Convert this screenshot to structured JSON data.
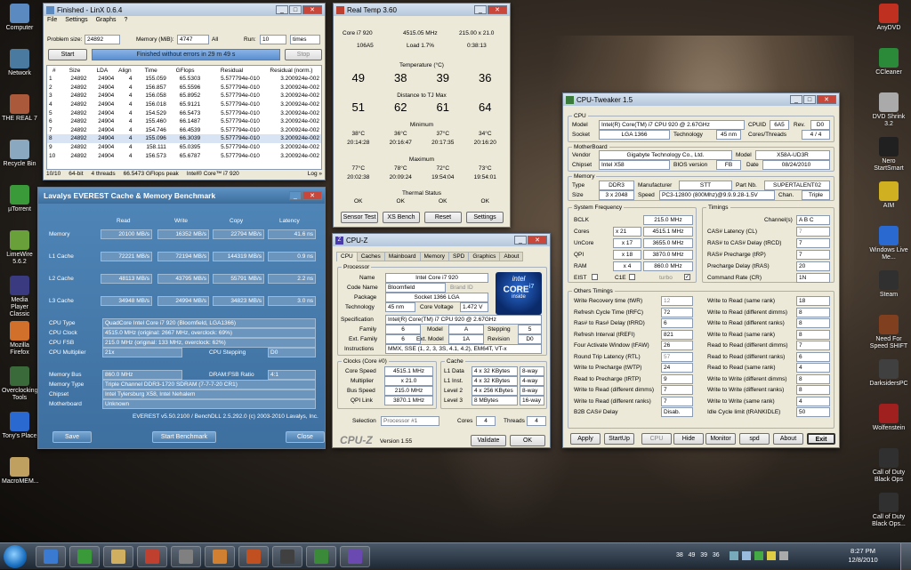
{
  "desktop": {
    "left_icons": [
      "Computer",
      "Network",
      "THE REAL 7",
      "Recycle Bin",
      "µTorrent",
      "LimeWire 5.6.2",
      "Media Player Classic",
      "Mozilla Firefox",
      "Overclocking Tools",
      "Tony's Place",
      "MacroMEM..."
    ],
    "right_icons": [
      "AnyDVD",
      "CCleaner",
      "DVD Shrink 3.2",
      "Nero StartSmart",
      "AIM",
      "Windows Live Me...",
      "Steam",
      "Need For Speed SHIFT",
      "DarksidersPC",
      "Wolfenstein",
      "Call of Duty Black Ops",
      "Call of Duty Black Ops..."
    ]
  },
  "linx": {
    "title": "Finished - LinX 0.6.4",
    "menu": [
      "File",
      "Settings",
      "Graphs",
      "?"
    ],
    "problem_size_label": "Problem size:",
    "problem_size": "24892",
    "memory_label": "Memory (MiB):",
    "memory": "4747",
    "all": "All",
    "run_label": "Run:",
    "run": "10",
    "run_unit": "times",
    "start": "Start",
    "status": "Finished without errors in 29 m 49 s",
    "stop": "Stop",
    "headers": [
      "#",
      "Size",
      "LDA",
      "Align",
      "Time",
      "GFlops",
      "Residual",
      "Residual (norm.)"
    ],
    "rows": [
      [
        "1",
        "24892",
        "24904",
        "4",
        "155.059",
        "65.5303",
        "5.577794e-010",
        "3.200924e-002"
      ],
      [
        "2",
        "24892",
        "24904",
        "4",
        "156.857",
        "65.5596",
        "5.577794e-010",
        "3.200924e-002"
      ],
      [
        "3",
        "24892",
        "24904",
        "4",
        "156.058",
        "65.8952",
        "5.577794e-010",
        "3.200924e-002"
      ],
      [
        "4",
        "24892",
        "24904",
        "4",
        "156.018",
        "65.9121",
        "5.577794e-010",
        "3.200924e-002"
      ],
      [
        "5",
        "24892",
        "24904",
        "4",
        "154.529",
        "66.5473",
        "5.577794e-010",
        "3.200924e-002"
      ],
      [
        "6",
        "24892",
        "24904",
        "4",
        "155.460",
        "66.1487",
        "5.577794e-010",
        "3.200924e-002"
      ],
      [
        "7",
        "24892",
        "24904",
        "4",
        "154.746",
        "66.4539",
        "5.577794e-010",
        "3.200924e-002"
      ],
      [
        "8",
        "24892",
        "24904",
        "4",
        "155.096",
        "66.3039",
        "5.577794e-010",
        "3.200924e-002"
      ],
      [
        "9",
        "24892",
        "24904",
        "4",
        "158.111",
        "65.0395",
        "5.577794e-010",
        "3.200924e-002"
      ],
      [
        "10",
        "24892",
        "24904",
        "4",
        "156.573",
        "65.6787",
        "5.577794e-010",
        "3.200924e-002"
      ]
    ],
    "footer": [
      "10/10",
      "64-bit",
      "4 threads",
      "66.5473 GFlops peak",
      "Intel® Core™ i7 920",
      "Log »"
    ]
  },
  "realtemp": {
    "title": "Real Temp 3.60",
    "cpu": "Core i7 920",
    "freq": "4515.05 MHz",
    "mult": "215.00 x 21.0",
    "id": "106A5",
    "load": "Load  1.7%",
    "time": "0:38:13",
    "temp_label": "Temperature (°C)",
    "temps": [
      "49",
      "38",
      "39",
      "36"
    ],
    "dist_label": "Distance to TJ Max",
    "dists": [
      "51",
      "62",
      "61",
      "64"
    ],
    "min_label": "Minimum",
    "mins": [
      "38°C",
      "36°C",
      "37°C",
      "34°C"
    ],
    "min_times": [
      "20:14:28",
      "20:16:47",
      "20:17:35",
      "20:16:20"
    ],
    "max_label": "Maximum",
    "maxs": [
      "77°C",
      "78°C",
      "72°C",
      "73°C"
    ],
    "max_times": [
      "20:02:38",
      "20:09:24",
      "19:54:04",
      "19:54:01"
    ],
    "thermal_label": "Thermal Status",
    "thermal": [
      "OK",
      "OK",
      "OK",
      "OK"
    ],
    "buttons": [
      "Sensor Test",
      "XS Bench",
      "Reset",
      "Settings"
    ]
  },
  "everest": {
    "title": "Lavalys EVEREST Cache & Memory Benchmark",
    "cols": [
      "Read",
      "Write",
      "Copy",
      "Latency"
    ],
    "rows": [
      {
        "label": "Memory",
        "v": [
          "20100 MB/s",
          "16352 MB/s",
          "22794 MB/s",
          "41.6 ns"
        ]
      },
      {
        "label": "L1 Cache",
        "v": [
          "72221 MB/s",
          "72194 MB/s",
          "144319 MB/s",
          "0.9 ns"
        ]
      },
      {
        "label": "L2 Cache",
        "v": [
          "48113 MB/s",
          "43795 MB/s",
          "55791 MB/s",
          "2.2 ns"
        ]
      },
      {
        "label": "L3 Cache",
        "v": [
          "34948 MB/s",
          "24994 MB/s",
          "34823 MB/s",
          "3.0 ns"
        ]
      }
    ],
    "cpu_type_label": "CPU Type",
    "cpu_type": "QuadCore Intel Core i7 920  (Bloomfield, LGA1366)",
    "cpu_clock_label": "CPU Clock",
    "cpu_clock": "4515.0 MHz  (original: 2667 MHz, overclock: 69%)",
    "cpu_fsb_label": "CPU FSB",
    "cpu_fsb": "215.0 MHz  (original: 133 MHz, overclock: 62%)",
    "cpu_mult_label": "CPU Multiplier",
    "cpu_mult": "21x",
    "cpu_step_label": "CPU Stepping",
    "cpu_step": "D0",
    "mem_bus_label": "Memory Bus",
    "mem_bus": "860.0 MHz",
    "dram_label": "DRAM:FSB Ratio",
    "dram": "4:1",
    "mem_type_label": "Memory Type",
    "mem_type": "Triple Channel DDR3-1720 SDRAM  (7-7-7-20 CR1)",
    "chipset_label": "Chipset",
    "chipset": "Intel Tylersburg X58, Intel Nehalem",
    "mobo_label": "Motherboard",
    "mobo": "Unknown",
    "footer": "EVEREST v5.50.2100 / BenchDLL 2.5.292.0  (c) 2003-2010 Lavalys, Inc.",
    "save": "Save",
    "start": "Start Benchmark",
    "close": "Close"
  },
  "cpuz": {
    "title": "CPU-Z",
    "tabs": [
      "CPU",
      "Caches",
      "Mainboard",
      "Memory",
      "SPD",
      "Graphics",
      "About"
    ],
    "processor": "Processor",
    "name_l": "Name",
    "name": "Intel Core i7 920",
    "code_l": "Code Name",
    "code": "Bloomfield",
    "brand_l": "Brand ID",
    "pkg_l": "Package",
    "pkg": "Socket 1366 LGA",
    "tech_l": "Technology",
    "tech": "45 nm",
    "volt_l": "Core Voltage",
    "volt": "1.472 V",
    "spec_l": "Specification",
    "spec": "Intel(R) Core(TM) i7 CPU      920  @ 2.67GHz",
    "fam_l": "Family",
    "fam": "6",
    "model_l": "Model",
    "model": "A",
    "step_l": "Stepping",
    "step": "5",
    "efam_l": "Ext. Family",
    "efam": "6",
    "emodel_l": "Ext. Model",
    "emodel": "1A",
    "rev_l": "Revision",
    "rev": "D0",
    "inst_l": "Instructions",
    "inst": "MMX, SSE (1, 2, 3, 3S, 4.1, 4.2), EM64T, VT-x",
    "clocks": "Clocks (Core #0)",
    "cache": "Cache",
    "cs_l": "Core Speed",
    "cs": "4515.1 MHz",
    "mul_l": "Multiplier",
    "mul": "x 21.0",
    "bs_l": "Bus Speed",
    "bs": "215.0 MHz",
    "qpi_l": "QPI Link",
    "qpi": "3870.1 MHz",
    "l1d_l": "L1 Data",
    "l1d": "4 x 32 KBytes",
    "l1d_w": "8-way",
    "l1i_l": "L1 Inst.",
    "l1i": "4 x 32 KBytes",
    "l1i_w": "4-way",
    "l2_l": "Level 2",
    "l2": "4 x 256 KBytes",
    "l2_w": "8-way",
    "l3_l": "Level 3",
    "l3": "8 MBytes",
    "l3_w": "16-way",
    "sel_l": "Selection",
    "sel": "Processor #1",
    "cores_l": "Cores",
    "cores": "4",
    "thr_l": "Threads",
    "thr": "4",
    "logo": "CPU-Z",
    "ver": "Version 1.55",
    "validate": "Validate",
    "ok": "OK",
    "badge_top": "intel",
    "badge_core": "CORE",
    "badge_i7": "i7",
    "badge_inside": "inside"
  },
  "tweaker": {
    "title": "CPU-Tweaker 1.5",
    "cpu": "CPU",
    "model_l": "Model",
    "model": "Intel(R) Core(TM) i7 CPU      920  @ 2.67GHz",
    "cpuid_l": "CPUID",
    "cpuid": "6A5",
    "rev_l": "Rev.",
    "rev": "D0",
    "socket_l": "Socket",
    "socket": "LGA 1366",
    "tech_l": "Technology",
    "tech": "45 nm",
    "ct_l": "Cores/Threads",
    "ct": "4 / 4",
    "mb": "MotherBoard",
    "vendor_l": "Vendor",
    "vendor": "Gigabyte Technology Co., Ltd.",
    "mbmodel_l": "Model",
    "mbmodel": "X58A-UD3R",
    "chipset_l": "Chipset",
    "chipset": "Intel X58",
    "bios_l": "BIOS version",
    "bios": "FB",
    "date_l": "Date",
    "date": "08/24/2010",
    "mem": "Memory",
    "type_l": "Type",
    "type": "DDR3",
    "manu_l": "Manufacturer",
    "manu": "STT",
    "part_l": "Part Nb.",
    "part": "SUPERTALENT02",
    "size_l": "Size",
    "size": "3 x 2048",
    "speed_l": "Speed",
    "speed": "PC3-12800 (800Mhz)@9.9.9.28-1.5V",
    "chan_l": "Chan.",
    "chan": "Triple",
    "sysfreq": "System Frequency",
    "bclk_l": "BCLK",
    "bclk": "215.0 MHz",
    "cores_l": "Cores",
    "cores_m": "x 21",
    "cores_v": "4515.1 MHz",
    "uncore_l": "UnCore",
    "uncore_m": "x 17",
    "uncore_v": "3655.0 MHz",
    "qpi_l": "QPI",
    "qpi_m": "x 18",
    "qpi_v": "3870.0 MHz",
    "ram_l": "RAM",
    "ram_m": "x 4",
    "ram_v": "860.0 MHz",
    "eist": "EIST",
    "c1e": "C1E",
    "turbo": "turbo",
    "timings": "Timings",
    "channel_l": "Channel(s)",
    "channel": "A B C",
    "cl_l": "CAS# Latency (CL)",
    "cl": "7",
    "trcd_l": "RAS# to CAS# Delay (tRCD)",
    "trcd": "7",
    "trp_l": "RAS# Precharge (tRP)",
    "trp": "7",
    "tras_l": "Precharge Delay (tRAS)",
    "tras": "20",
    "cr_l": "Command Rate (CR)",
    "cr": "1N",
    "others": "Others Timings",
    "left": [
      [
        "Write Recovery time (tWR)",
        "12"
      ],
      [
        "Refresh Cycle Time (tRFC)",
        "72"
      ],
      [
        "Ras# to Ras# Delay (tRRD)",
        "6"
      ],
      [
        "Refresh Interval (tREFI)",
        "821"
      ],
      [
        "Four Activate Window (tFAW)",
        "26"
      ],
      [
        "Round Trip Latency (RTL)",
        "57"
      ],
      [
        "Write to Precharge (tWTP)",
        "24"
      ],
      [
        "Read to Precharge (tRTP)",
        "9"
      ],
      [
        "Write to Read (different dimms)",
        "7"
      ],
      [
        "Write to Read (different ranks)",
        "7"
      ],
      [
        "B2B CAS# Delay",
        "Disab."
      ]
    ],
    "right": [
      [
        "Write to Read (same rank)",
        "18"
      ],
      [
        "Write to Read (different dimms)",
        "8"
      ],
      [
        "Write to Read (different ranks)",
        "8"
      ],
      [
        "Write to Read (same rank)",
        "8"
      ],
      [
        "Read to Read (different dimms)",
        "7"
      ],
      [
        "Read to Read (different ranks)",
        "6"
      ],
      [
        "Read to Read (same rank)",
        "4"
      ],
      [
        "Write to Write (different dimms)",
        "8"
      ],
      [
        "Write to Write (different ranks)",
        "8"
      ],
      [
        "Write to Write (same rank)",
        "4"
      ],
      [
        "Idle Cycle limit (tRANKIDLE)",
        "50"
      ]
    ],
    "buttons": [
      "Apply",
      "StartUp",
      "CPU",
      "Hide",
      "Monitor",
      "spd",
      "About",
      "Exit"
    ]
  },
  "taskbar": {
    "time": "8:27 PM",
    "date": "12/8/2010",
    "tray": "38   49   39   36"
  }
}
